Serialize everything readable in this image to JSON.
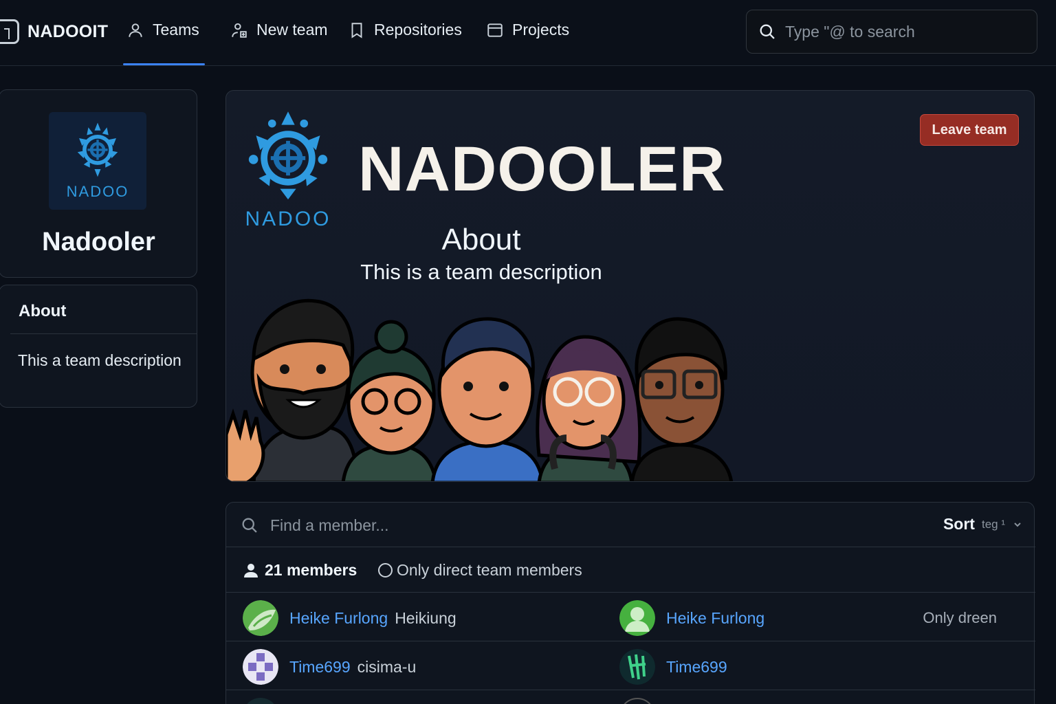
{
  "nav": {
    "brand": "NADOOIT",
    "items": [
      {
        "label": "Teams",
        "icon": "person-icon"
      },
      {
        "label": "New team",
        "icon": "people-icon"
      },
      {
        "label": "Repositories",
        "icon": "bookmark-icon"
      },
      {
        "label": "Projects",
        "icon": "project-icon"
      }
    ],
    "active": "Teams",
    "search_placeholder": "Type \"@ to search"
  },
  "team": {
    "logo_text": "NADOO",
    "name": "Nadooler",
    "about_title": "About",
    "about_text": "This a team description"
  },
  "banner": {
    "logo_text": "NADOO",
    "title": "NADOOLER",
    "about_heading": "About",
    "about_text": "This is a team description",
    "leave_button": "Leave team"
  },
  "members": {
    "search_placeholder": "Find a member...",
    "sort_label": "Sort",
    "sort_value": "teg ¹",
    "count": "21 members",
    "filter_label": "Only direct team members",
    "rows": [
      {
        "left": {
          "name": "Heike Furlong",
          "handle": "Heikiung",
          "avatar": "avatar-green-leaf"
        },
        "right": {
          "name": "Heike Furlong",
          "handle": "",
          "avatar": "avatar-green-person",
          "status": "Only dreen"
        }
      },
      {
        "left": {
          "name": "Time699",
          "handle": "cisima-u",
          "avatar": "avatar-purple-pixel"
        },
        "right": {
          "name": "Time699",
          "handle": "",
          "avatar": "avatar-dark-green",
          "status": ""
        }
      }
    ]
  },
  "colors": {
    "background": "#0a0f18",
    "accent": "#3b82f6",
    "link": "#58a6ff",
    "danger": "#962d24",
    "logo_blue": "#2f9be0"
  }
}
